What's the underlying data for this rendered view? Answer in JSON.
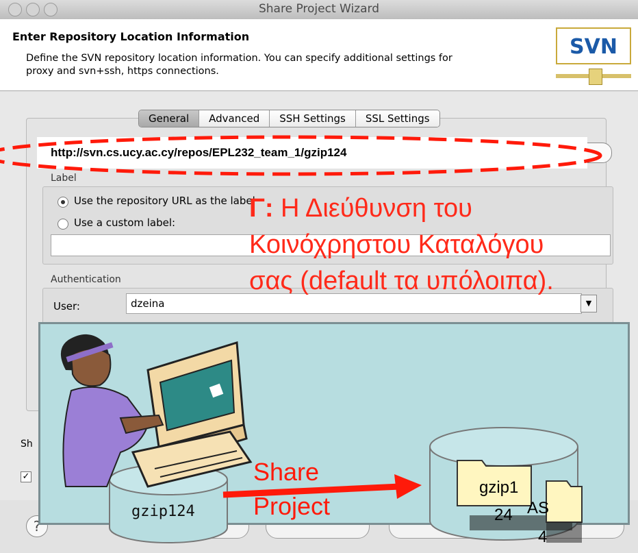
{
  "window": {
    "title": "Share Project Wizard"
  },
  "header": {
    "title": "Enter Repository Location Information",
    "description": "Define the SVN repository location information. You can specify additional settings for proxy and svn+ssh, https connections.",
    "logo_text": "SVN"
  },
  "tabs": [
    {
      "label": "General",
      "active": true
    },
    {
      "label": "Advanced"
    },
    {
      "label": "SSH Settings"
    },
    {
      "label": "SSL Settings"
    }
  ],
  "url": {
    "value": "http://svn.cs.ucy.ac.cy/repos/EPL232_team_1/gzip124"
  },
  "label_group": {
    "title": "Label",
    "option_repo": "Use the repository URL as the label",
    "option_custom": "Use a custom label:"
  },
  "auth": {
    "title": "Authentication",
    "user_label": "User:",
    "user_value": "dzeina"
  },
  "annotation": {
    "prefix": "Γ:",
    "line1": " Η Διεύθυνση του",
    "line2": "Κοινόχρηστου Καταλόγου",
    "line3": "σας (default τα υπόλοιπα)."
  },
  "bottom": {
    "share_label": "Sh",
    "help_icon": "?"
  },
  "overlay": {
    "share_line1": "Share",
    "share_line2": "Project",
    "local_label": "gzip124",
    "folder1_line1": "gzip1",
    "folder1_line2": "24",
    "folder2_line1": "AS",
    "folder2_line2": "4"
  },
  "colors": {
    "annotation_red": "#ff2a1a",
    "overlay_bg": "#b7dde0",
    "svn_blue": "#1b5aa8"
  }
}
